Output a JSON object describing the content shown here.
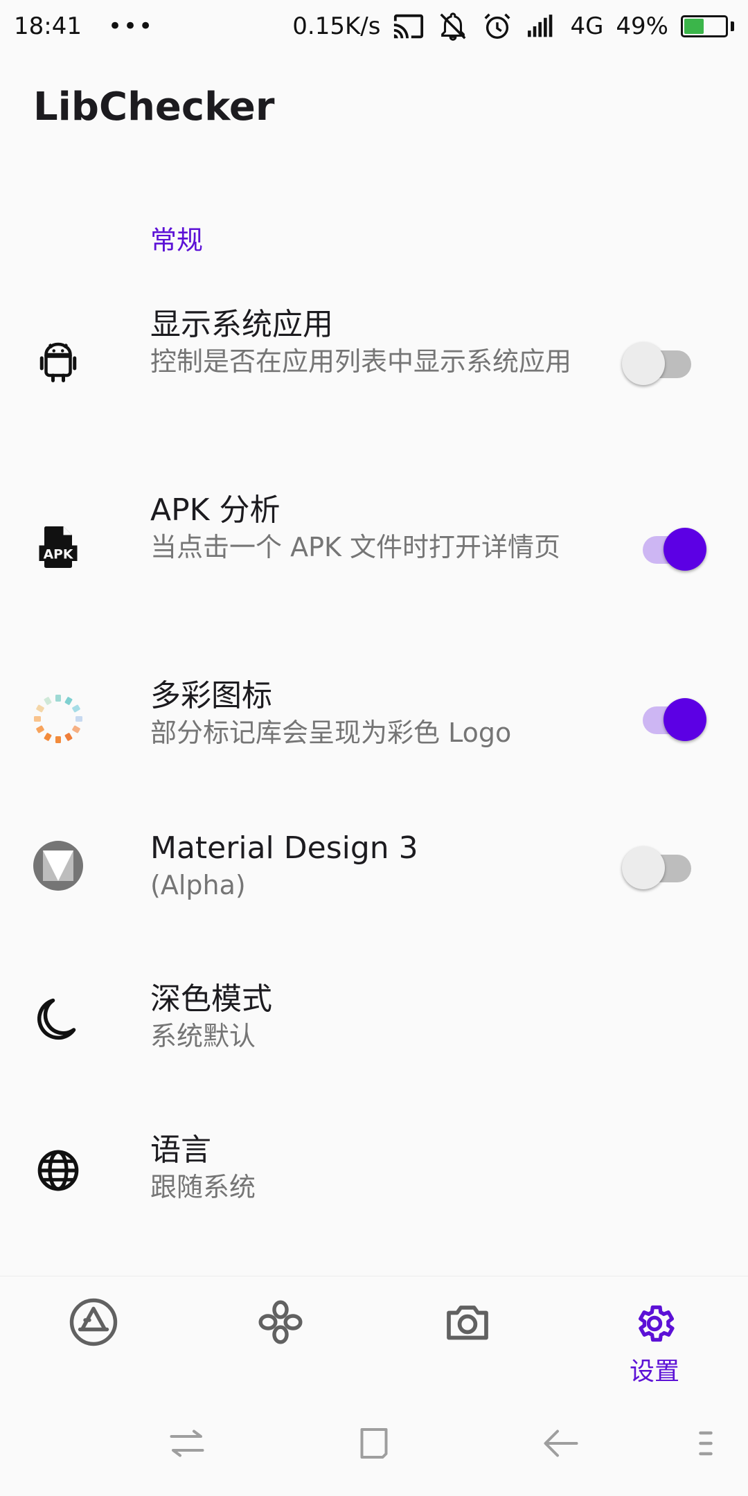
{
  "status_bar": {
    "time": "18:41",
    "dots": "•••",
    "speed": "0.15K/s",
    "network": "4G",
    "battery": "49%",
    "battery_level": 0.49,
    "icons": [
      "cast-icon",
      "bell-off-icon",
      "alarm-icon",
      "signal-icon",
      "battery-icon"
    ]
  },
  "app": {
    "title": "LibChecker"
  },
  "section": {
    "header": "常规"
  },
  "settings": [
    {
      "title": "显示系统应用",
      "summary": "控制是否在应用列表中显示系统应用",
      "icon": "android-icon",
      "toggle": false
    },
    {
      "title": "APK 分析",
      "summary": "当点击一个 APK 文件时打开详情页",
      "icon": "apk-file-icon",
      "toggle": true
    },
    {
      "title": "多彩图标",
      "summary": "部分标记库会呈现为彩色 Logo",
      "icon": "colorful-ring-icon",
      "toggle": true
    },
    {
      "title": "Material Design 3",
      "summary": "(Alpha)",
      "icon": "material-design-icon",
      "toggle": false
    },
    {
      "title": "深色模式",
      "summary": "系统默认",
      "icon": "moon-icon"
    },
    {
      "title": "语言",
      "summary": "跟随系统",
      "icon": "globe-icon"
    }
  ],
  "bottom_nav": {
    "items": [
      {
        "icon": "app-store-icon"
      },
      {
        "icon": "snapshot-icon"
      },
      {
        "icon": "camera-icon"
      },
      {
        "icon": "gear-icon",
        "label": "设置",
        "active": true
      }
    ]
  },
  "colors": {
    "accent": "#5C11D6",
    "switch_on": "#5C00E4",
    "switch_on_track": "#CDB6F3",
    "background": "#FAFAFA"
  }
}
